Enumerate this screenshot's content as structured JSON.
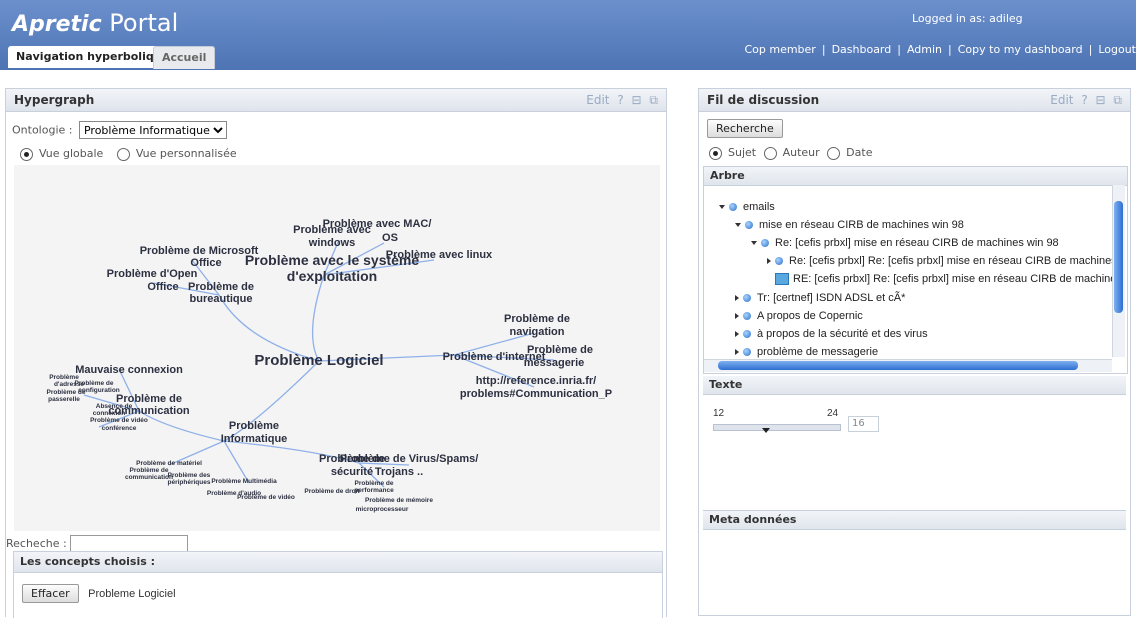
{
  "header": {
    "logo_brand": "Apretic",
    "logo_product": "Portal",
    "logged_in": "Logged in as: adileg",
    "links": [
      "Cop member",
      "Dashboard",
      "Admin",
      "Copy to my dashboard",
      "Logout"
    ],
    "tabs": [
      {
        "label": "Navigation hyperbolique",
        "active": true
      },
      {
        "label": "Accueil",
        "active": false
      }
    ]
  },
  "hypergraph": {
    "title": "Hypergraph",
    "edit_label": "Edit",
    "help_label": "?",
    "ontology_label": "Ontologie :",
    "ontology_value": "Problème Informatique",
    "radio_global": "Vue globale",
    "radio_personal": "Vue personnalisée",
    "search_label": "Recheche :",
    "concepts_title": "Les concepts choisis :",
    "clear_button": "Effacer",
    "chosen_concept": "Probleme Logiciel",
    "nodes": {
      "center": "Problème Logiciel",
      "os": [
        "Problème avec le système",
        "d'exploitation"
      ],
      "windows": [
        "Problème avec",
        "windows"
      ],
      "mac": [
        "Problème avec MAC/",
        "OS"
      ],
      "linux": "Problème avec linux",
      "microsoft": [
        "Problème de Microsoft",
        "Office"
      ],
      "openoffice": [
        "Problème d'Open",
        "Office"
      ],
      "bureautique": [
        "Problème de",
        "bureautique"
      ],
      "internet": "Problème d'internet",
      "navigation": [
        "Problème de",
        "navigation"
      ],
      "messagerie": [
        "Problème de",
        "messagerie"
      ],
      "url": [
        "http://reference.inria.fr/",
        "problems#Communication_P"
      ],
      "mauvaise": "Mauvaise connexion",
      "communication": [
        "Problème de",
        "communication"
      ],
      "informatique": [
        "Problème",
        "Informatique"
      ],
      "securite": [
        "Problème de",
        "sécurité"
      ],
      "virus": [
        "Problème de Virus/Spams/",
        "Trojans .."
      ],
      "small_left": [
        "Problème",
        "d'adresse",
        "Problème de",
        "configuration",
        "Problème de",
        "passerelle",
        "Absence de",
        "connexion",
        "Problème de vidéo",
        "conférence"
      ],
      "small_bottom": [
        "Problème de matériel",
        "Problème de",
        "communication",
        "Problème des",
        "périphériques",
        "Problème Multimédia",
        "Problème d'audio",
        "Problème de vidéo",
        "Problème de droit",
        "Problème de",
        "performance",
        "Problème de mémoire",
        "microprocesseur"
      ]
    }
  },
  "discussion": {
    "title": "Fil de discussion",
    "edit_label": "Edit",
    "help_label": "?",
    "search_button": "Recherche",
    "radios": [
      "Sujet",
      "Auteur",
      "Date"
    ],
    "tree_title": "Arbre",
    "tree": [
      {
        "label": "emails",
        "level": 0,
        "arrow": "down",
        "icon": "node"
      },
      {
        "label": "mise en réseau CIRB de machines win 98",
        "level": 1,
        "arrow": "down",
        "icon": "node"
      },
      {
        "label": "Re: [cefis prbxl] mise en réseau CIRB de machines win 98",
        "level": 2,
        "arrow": "down",
        "icon": "node"
      },
      {
        "label": "Re: [cefis prbxl] Re: [cefis prbxl] mise en réseau CIRB de machines win",
        "level": 3,
        "arrow": "right",
        "icon": "node"
      },
      {
        "label": "RE: [cefis prbxl] Re: [cefis prbxl] mise en réseau CIRB de machines win",
        "level": 3,
        "arrow": "none",
        "icon": "message"
      },
      {
        "label": "Tr: [certnef] ISDN ADSL et cÃ*",
        "level": 1,
        "arrow": "right",
        "icon": "node"
      },
      {
        "label": "A propos de Copernic",
        "level": 1,
        "arrow": "right",
        "icon": "node"
      },
      {
        "label": "à propos de la sécurité et des virus",
        "level": 1,
        "arrow": "right",
        "icon": "node"
      },
      {
        "label": "problème de messagerie",
        "level": 1,
        "arrow": "right",
        "icon": "node"
      }
    ],
    "text_title": "Texte",
    "slider_min": "12",
    "slider_max": "24",
    "slider_value": "16",
    "meta_title": "Meta données"
  }
}
